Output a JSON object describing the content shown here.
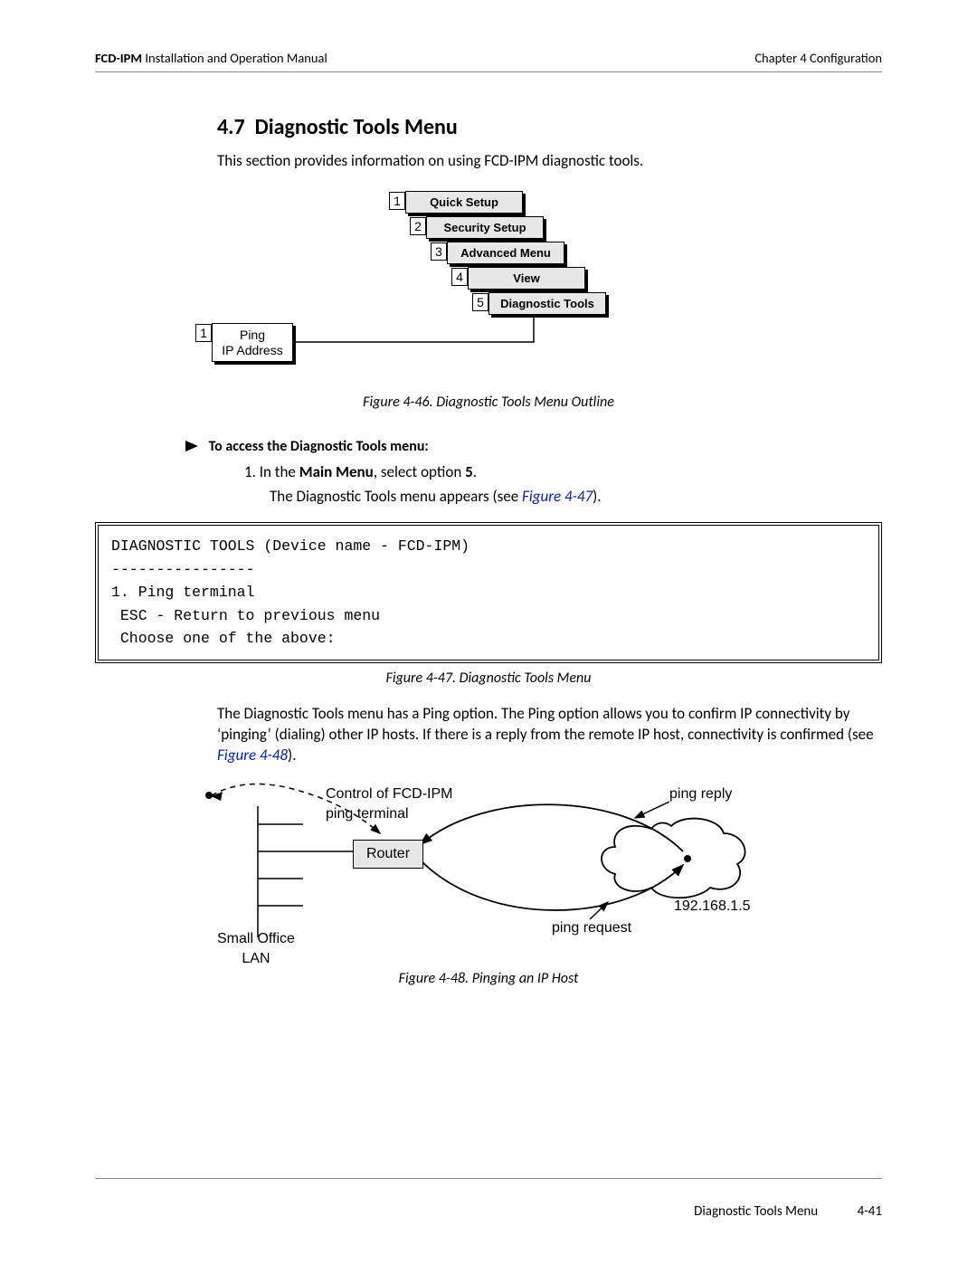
{
  "header": {
    "product": "FCD-IPM",
    "doc": "Installation and Operation Manual",
    "chapter": "Chapter 4  Configuration"
  },
  "section": {
    "number": "4.7",
    "title": "Diagnostic Tools Menu",
    "intro": "This section provides information on using FCD-IPM diagnostic tools."
  },
  "fig46": {
    "items": [
      {
        "n": "1",
        "label": "Quick Setup"
      },
      {
        "n": "2",
        "label": "Security Setup"
      },
      {
        "n": "3",
        "label": "Advanced Menu"
      },
      {
        "n": "4",
        "label": "View"
      },
      {
        "n": "5",
        "label": "Diagnostic Tools"
      }
    ],
    "sub": {
      "n": "1",
      "line1": "Ping",
      "line2": "IP Address"
    },
    "caption": "Figure 4-46.  Diagnostic Tools Menu Outline"
  },
  "procedure": {
    "lead": "To access the Diagnostic Tools menu:",
    "step1_pre": "1.   In the ",
    "step1_bold": "Main Menu",
    "step1_post": ", select option ",
    "step1_opt": "5",
    "step1_end": ".",
    "result_pre": "The Diagnostic Tools menu appears (see ",
    "result_link": "Figure 4-47",
    "result_post": ")."
  },
  "terminal": "DIAGNOSTIC TOOLS (Device name - FCD-IPM)\n----------------\n1. Ping terminal\n ESC - Return to previous menu\n Choose one of the above:",
  "fig47": {
    "caption": "Figure 4-47.  Diagnostic Tools Menu"
  },
  "para2": {
    "text_pre": "The Diagnostic Tools menu has a Ping option. The Ping option allows you to confirm IP connectivity by ‘pinging’ (dialing) other IP hosts. If there is a reply from the remote IP host, connectivity is confirmed (see ",
    "link": "Figure 4-48",
    "text_post": ")."
  },
  "fig48": {
    "control_label": "Control of FCD-IPM\nping terminal",
    "router": "Router",
    "ping_reply": "ping reply",
    "ping_request": "ping request",
    "ip": "192.168.1.5",
    "lan": "Small Office\nLAN",
    "caption": "Figure 4-48.  Pinging an IP Host"
  },
  "footer": {
    "title": "Diagnostic Tools Menu",
    "page": "4-41"
  }
}
